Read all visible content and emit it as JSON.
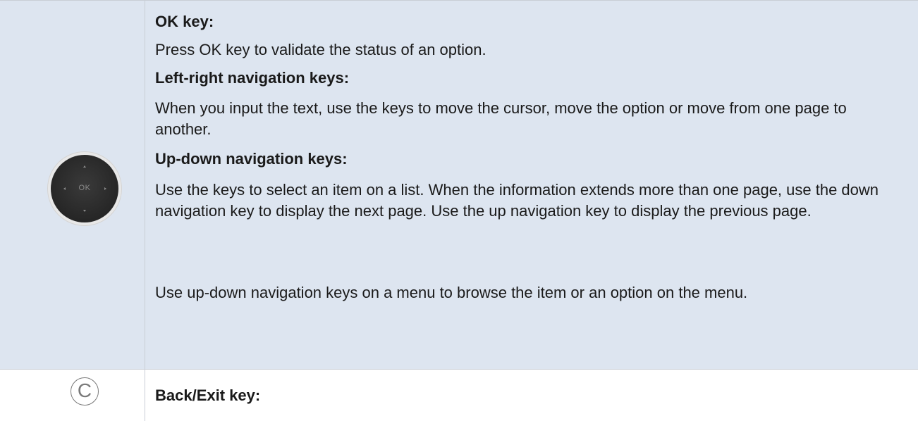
{
  "nav_row": {
    "icon": {
      "name": "navigation-pad-icon",
      "label": "OK"
    },
    "ok_heading": "OK key:",
    "ok_text": "Press OK key to validate the status of an option.",
    "lr_heading": "Left-right navigation keys:",
    "lr_text": "When you input the text, use the keys to move the cursor, move the option or move from one page to another.",
    "ud_heading": "Up-down navigation keys:",
    "ud_text_1": "Use the keys to select an item on a list. When the information extends more than one page, use the down navigation key to display the next page. Use the up navigation key to display the previous page.",
    "ud_text_2": "Use up-down navigation keys on a menu to browse the item or an option on the menu."
  },
  "back_row": {
    "icon": {
      "name": "c-key-icon",
      "label": "C"
    },
    "heading": "Back/Exit key:"
  },
  "colors": {
    "highlight_row": "#dde5f0",
    "divider": "#c9ced6",
    "text": "#1a1a1a"
  }
}
